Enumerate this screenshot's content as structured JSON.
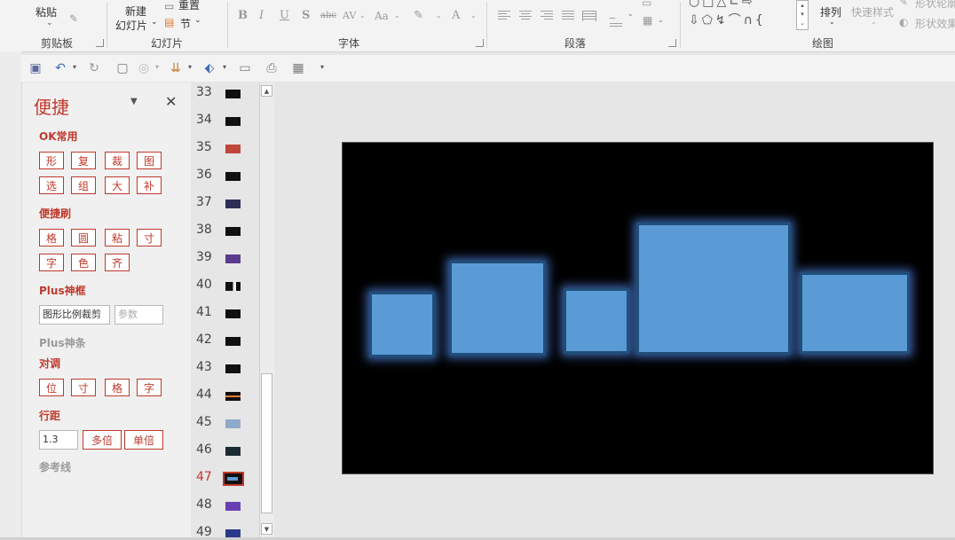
{
  "ribbon": {
    "clipboard": {
      "paste_label": "粘贴",
      "group_label": "剪贴板"
    },
    "slides": {
      "new_slide_line1": "新建",
      "new_slide_line2": "幻灯片",
      "reset_label": "重置",
      "section_label": "节",
      "group_label": "幻灯片"
    },
    "font": {
      "group_label": "字体",
      "bold": "B",
      "italic": "I",
      "underline": "U",
      "shadow": "S",
      "strike": "abc",
      "spacing": "AV",
      "case": "Aa",
      "color": "A"
    },
    "paragraph": {
      "group_label": "段落"
    },
    "drawing": {
      "group_label": "绘图",
      "arrange_label": "排列",
      "quick_styles_label": "快速样式",
      "shape_outline_label": "形状轮廓",
      "shape_effects_label": "形状效果"
    }
  },
  "qat": {
    "icons": [
      "save-icon",
      "undo-icon",
      "redo-icon",
      "presentation-icon",
      "shapes-icon",
      "format-painter-icon",
      "select-icon",
      "textbox-icon",
      "print-preview-icon",
      "grid-icon",
      "customize-icon"
    ]
  },
  "pane": {
    "title": "便捷",
    "section_ok": "OK常用",
    "ok_buttons": [
      "形",
      "复",
      "裁",
      "图",
      "选",
      "组",
      "大",
      "补"
    ],
    "section_brush": "便捷刷",
    "brush_buttons": [
      "格",
      "圆",
      "粘",
      "寸",
      "字",
      "色",
      "齐"
    ],
    "section_plus_frame": "Plus神框",
    "crop_field_value": "图形比例裁剪",
    "param_placeholder": "参数",
    "section_plus_bar": "Plus神条",
    "section_align": "对调",
    "align_buttons": [
      "位",
      "寸",
      "格",
      "字"
    ],
    "section_spacing": "行距",
    "spacing_value": "1.3",
    "multi_label": "多倍",
    "single_label": "单倍",
    "section_guides": "参考线"
  },
  "thumbnails": {
    "numbers": [
      "33",
      "34",
      "35",
      "36",
      "37",
      "38",
      "39",
      "40",
      "41",
      "42",
      "43",
      "44",
      "45",
      "46",
      "47",
      "48",
      "49"
    ],
    "selected": "47"
  },
  "slide": {
    "background": "#000000",
    "bar_color": "#5b9bd5",
    "bar_border": "#1f4e79",
    "glow": "#4472c4"
  },
  "colors": {
    "accent": "#c0392b"
  }
}
